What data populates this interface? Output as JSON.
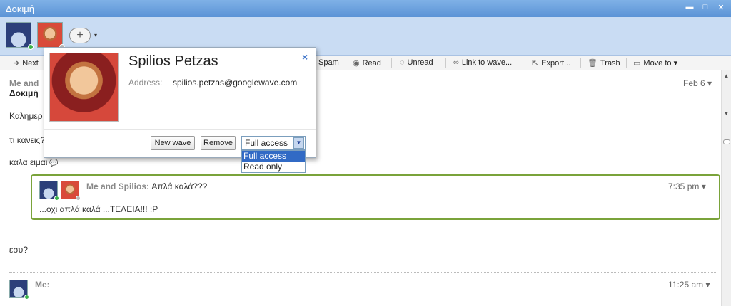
{
  "window": {
    "title": "Δοκιμή",
    "controls": [
      "▬",
      "□",
      "✕"
    ]
  },
  "participants": {
    "avatars": [
      {
        "name": "me-avatar",
        "icon": "globe-avatar-icon",
        "status": "online"
      },
      {
        "name": "spilios-avatar",
        "icon": "face-avatar-icon",
        "status": "offline"
      }
    ],
    "add_label": "+",
    "add_menu_caret": "▾"
  },
  "toolbar": {
    "next_label": "Next",
    "spam_label": "Spam",
    "read_label": "Read",
    "unread_label": "Unread",
    "link_label": "Link to wave...",
    "export_label": "Export...",
    "trash_label": "Trash",
    "move_label": "Move to",
    "move_caret": "▾"
  },
  "wave": {
    "header": "Me and",
    "subject": "Δοκιμή",
    "date": "Feb 6",
    "date_caret": "▾",
    "messages": [
      "Καλημερ",
      "τι κανεις?",
      "καλα ειμαι"
    ],
    "reply": {
      "who": "Me and Spilios:",
      "snippet": "Απλά καλά???",
      "time": "7:35 pm",
      "body": "...οχι απλά καλά ...ΤΕΛΕΙΑ!!! :P"
    },
    "after_reply": "εσυ?",
    "last_blip": {
      "who": "Me:",
      "time": "11:25 am"
    }
  },
  "popup": {
    "name": "Spilios Petzas",
    "address_label": "Address:",
    "address": "spilios.petzas@googlewave.com",
    "close_glyph": "×",
    "new_wave_label": "New wave",
    "remove_label": "Remove",
    "access_selected": "Full access",
    "access_options": [
      "Full access",
      "Read only"
    ]
  },
  "colors": {
    "titlebar": "#5b93d6",
    "participants_bg": "#c9dcf3",
    "reply_border": "#7aa33a",
    "dropdown_highlight": "#316ac5"
  }
}
